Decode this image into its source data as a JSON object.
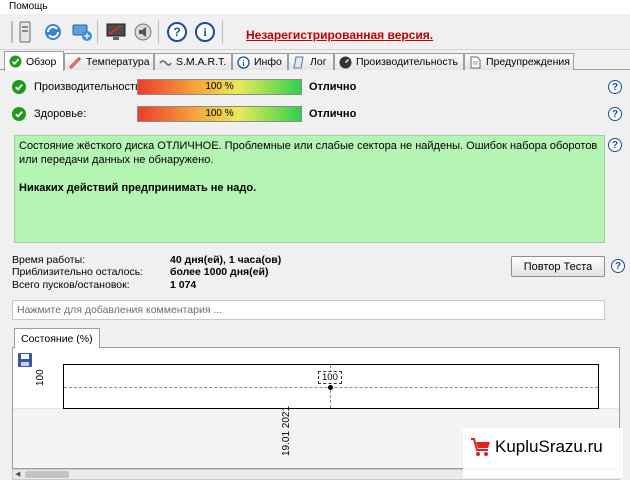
{
  "menu": {
    "help": "Помощь"
  },
  "toolbar": {
    "unregistered": "Незарегистрированная версия."
  },
  "tabs": [
    {
      "label": "Обзор"
    },
    {
      "label": "Температура"
    },
    {
      "label": "S.M.A.R.T."
    },
    {
      "label": "Инфо"
    },
    {
      "label": "Лог"
    },
    {
      "label": "Производительность"
    },
    {
      "label": "Предупреждения"
    }
  ],
  "overview": {
    "performance": {
      "label": "Производительность:",
      "value": "100 %",
      "percent": 100,
      "status": "Отлично"
    },
    "health": {
      "label": "Здоровье:",
      "value": "100 %",
      "percent": 100,
      "status": "Отлично"
    },
    "summary": {
      "text": "Состояние жёсткого диска ОТЛИЧНОЕ. Проблемные или слабые сектора не найдены. Ошибок набора оборотов или передачи данных не обнаружено.",
      "action": "Никаких действий предпринимать не надо."
    },
    "stats": [
      {
        "label": "Время работы:",
        "value": "40 дня(ей), 1 часа(ов)"
      },
      {
        "label": "Приблизительно осталось:",
        "value": "более 1000 дня(ей)"
      },
      {
        "label": "Всего пусков/остановок:",
        "value": "1 074"
      }
    ],
    "retest_button": "Повтор Теста",
    "comment_placeholder": "Нажмите для добавления комментария ..."
  },
  "chart": {
    "tab_label": "Состояние (%)"
  },
  "chart_data": {
    "type": "line",
    "x": [
      "19.01 2021"
    ],
    "series": [
      {
        "values": [
          100
        ]
      }
    ],
    "ytick": "100",
    "point_label": "100"
  },
  "watermark": {
    "text": "KupluSrazu.ru"
  },
  "colors": {
    "unregistered": "#c00000",
    "summary_bg": "#b4f5b4",
    "ok": "#1f9a1f"
  }
}
